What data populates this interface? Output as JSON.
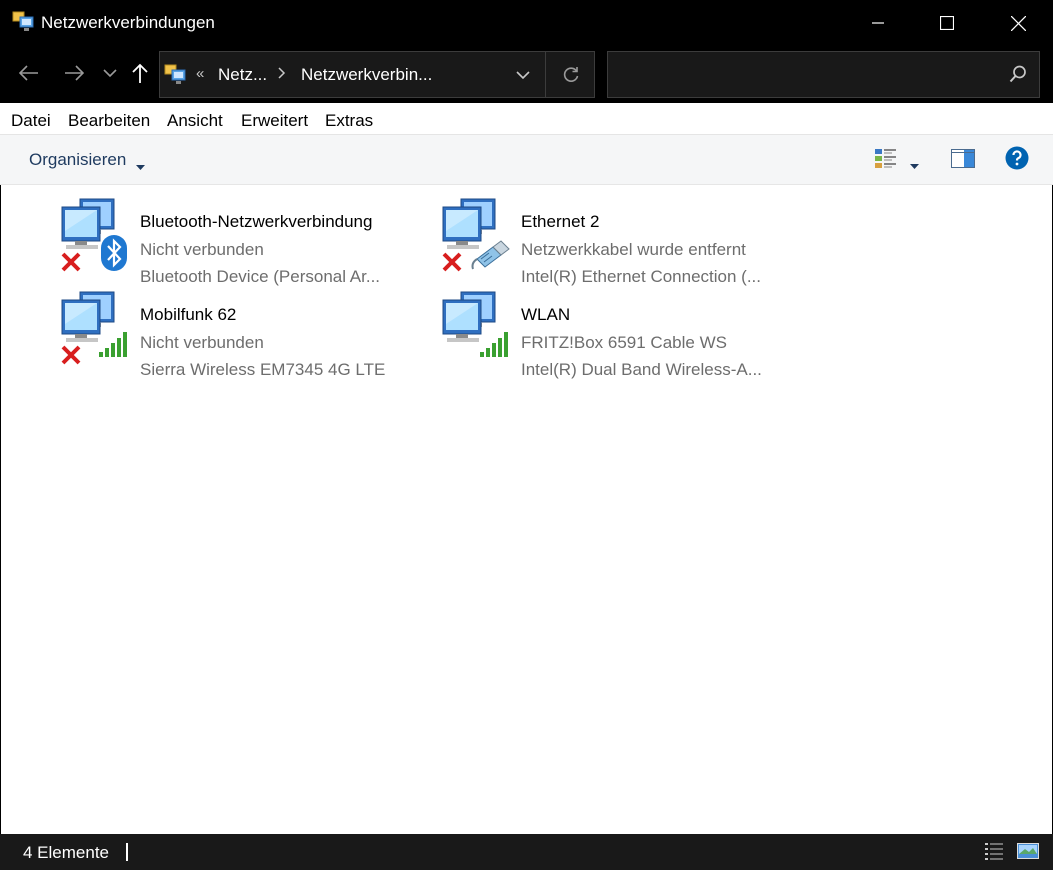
{
  "window": {
    "title": "Netzwerkverbindungen",
    "icon": "network-connections-icon"
  },
  "address": {
    "prefix": "«",
    "crumbs": [
      "Netz...",
      "Netzwerkverbin..."
    ]
  },
  "search": {
    "placeholder": ""
  },
  "menu": [
    "Datei",
    "Bearbeiten",
    "Ansicht",
    "Erweitert",
    "Extras"
  ],
  "toolbar": {
    "organize_label": "Organisieren"
  },
  "items": [
    {
      "name": "Bluetooth-Netzwerkverbindung",
      "status": "Nicht verbunden",
      "device": "Bluetooth Device (Personal Ar...",
      "overlay": "bluetooth",
      "disconnected": true
    },
    {
      "name": "Ethernet 2",
      "status": "Netzwerkkabel wurde entfernt",
      "device": "Intel(R) Ethernet Connection (...",
      "overlay": "ethernet-cable",
      "disconnected": true
    },
    {
      "name": "Mobilfunk 62",
      "status": "Nicht verbunden",
      "device": "Sierra Wireless EM7345 4G LTE",
      "overlay": "signal-bars",
      "disconnected": true
    },
    {
      "name": "WLAN",
      "status": "FRITZ!Box 6591 Cable WS",
      "device": "Intel(R) Dual Band Wireless-A...",
      "overlay": "signal-bars",
      "disconnected": false
    }
  ],
  "status": {
    "count_label": "4 Elemente"
  },
  "colors": {
    "accent": "#0063b1",
    "titlebar": "#000000",
    "statusbar": "#191919",
    "signal": "#3aa030",
    "error": "#d81e1e"
  }
}
